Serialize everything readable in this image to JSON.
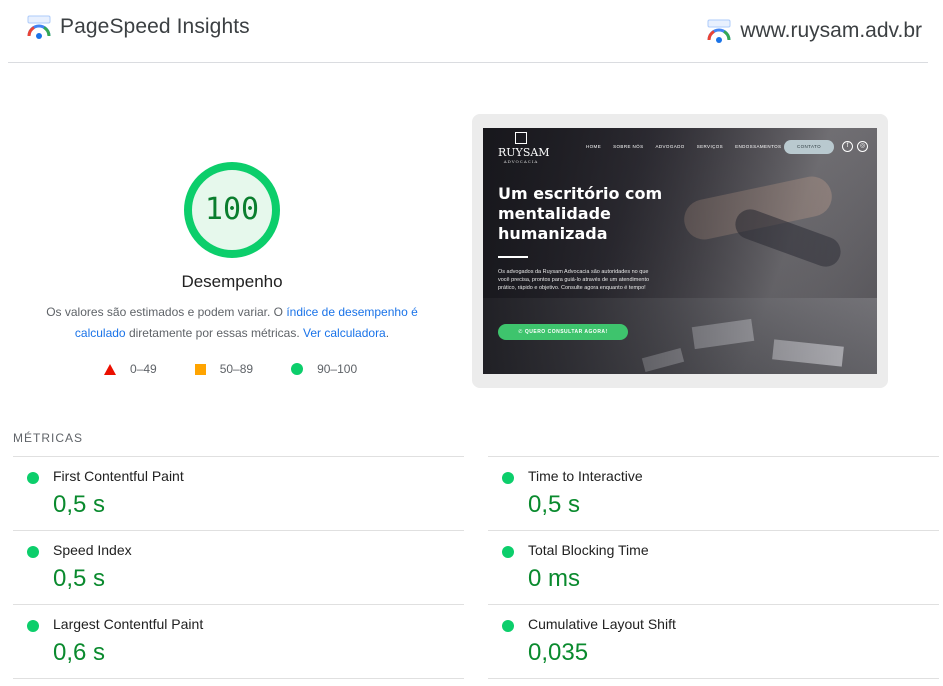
{
  "header": {
    "brand_title": "PageSpeed Insights",
    "site_url": "www.ruysam.adv.br",
    "icon": "pagespeed-gauge-icon"
  },
  "score": {
    "value": "100",
    "fraction": 1.0,
    "label": "Desempenho",
    "color": "#0cce6b",
    "desc_part1": "Os valores são estimados e podem variar. O ",
    "desc_link1": "índice de desempenho é calculado",
    "desc_part2": " diretamente por essas métricas. ",
    "desc_link2": "Ver calculadora",
    "desc_part3": "."
  },
  "legend": [
    {
      "range": "0–49",
      "shape": "triangle",
      "color": "#eb0f00"
    },
    {
      "range": "50–89",
      "shape": "square",
      "color": "#ffa400"
    },
    {
      "range": "90–100",
      "shape": "circle",
      "color": "#0cce6b"
    }
  ],
  "screenshot": {
    "logo": "RUYSAM",
    "logo_sub": "ADVOCACIA",
    "nav": [
      "HOME",
      "SOBRE NÓS",
      "ADVOGADO",
      "SERVIÇOS",
      "ENDOSSAMENTOS"
    ],
    "contact": "CONTATO",
    "social_facebook": "f",
    "social_instagram": "◎",
    "headline": "Um escritório com mentalidade humanizada",
    "body": "Os advogados da Ruysam Advocacia são autoridades no que você precisa, prontos para guiá-lo através de um atendimento prático, rápido e objetivo. Consulte agora enquanto é tempo!",
    "cta": "✆ QUERO CONSULTAR AGORA!"
  },
  "metrics": {
    "title": "MÉTRICAS",
    "items": [
      {
        "name": "First Contentful Paint",
        "value": "0,5 s"
      },
      {
        "name": "Time to Interactive",
        "value": "0,5 s"
      },
      {
        "name": "Speed Index",
        "value": "0,5 s"
      },
      {
        "name": "Total Blocking Time",
        "value": "0 ms"
      },
      {
        "name": "Largest Contentful Paint",
        "value": "0,6 s"
      },
      {
        "name": "Cumulative Layout Shift",
        "value": "0,035"
      }
    ]
  }
}
